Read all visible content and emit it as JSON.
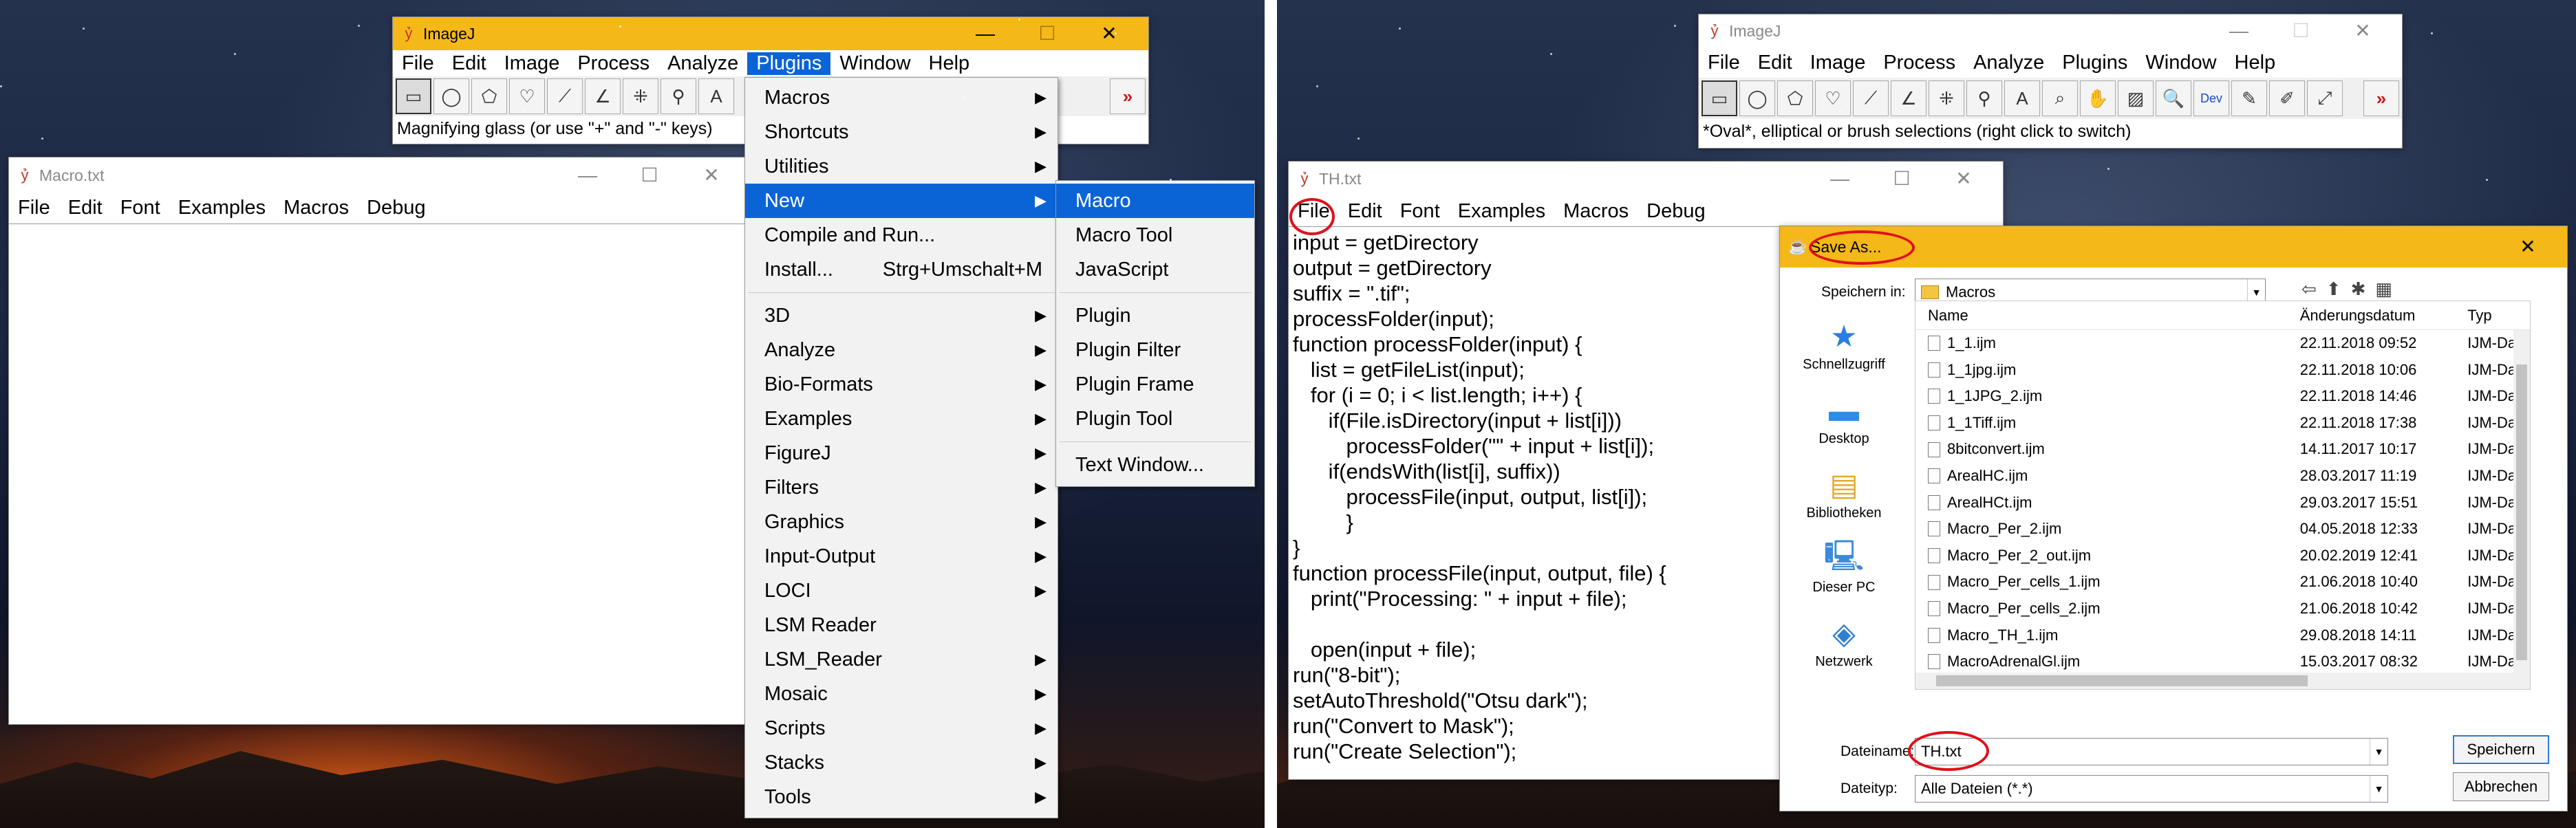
{
  "left_screen": {
    "imagej": {
      "title": "ImageJ",
      "menus": [
        "File",
        "Edit",
        "Image",
        "Process",
        "Analyze",
        "Plugins",
        "Window",
        "Help"
      ],
      "open_menu": "Plugins",
      "tools": [
        {
          "icon": "rectangle-tool-icon",
          "glyph": "▭"
        },
        {
          "icon": "oval-tool-icon",
          "glyph": "◯"
        },
        {
          "icon": "polygon-tool-icon",
          "glyph": "⬠"
        },
        {
          "icon": "freehand-tool-icon",
          "glyph": "♡"
        },
        {
          "icon": "line-tool-icon",
          "glyph": "⟋"
        },
        {
          "icon": "angle-tool-icon",
          "glyph": "∠"
        },
        {
          "icon": "point-tool-icon",
          "glyph": "⁜"
        },
        {
          "icon": "wand-tool-icon",
          "glyph": "⚲"
        },
        {
          "icon": "text-tool-icon",
          "glyph": "A"
        }
      ],
      "more_tools_glyph": "»",
      "status": "Magnifying glass (or use \"+\" and \"-\" keys)"
    },
    "macro_window": {
      "title": "Macro.txt",
      "menus": [
        "File",
        "Edit",
        "Font",
        "Examples",
        "Macros",
        "Debug"
      ]
    },
    "plugins_menu": {
      "items": [
        {
          "label": "Macros",
          "submenu": true
        },
        {
          "label": "Shortcuts",
          "submenu": true
        },
        {
          "label": "Utilities",
          "submenu": true
        },
        {
          "label": "New",
          "submenu": true,
          "highlighted": true
        },
        {
          "label": "Compile and Run...",
          "submenu": false
        },
        {
          "label": "Install...",
          "submenu": false,
          "shortcut": "Strg+Umschalt+M"
        },
        {
          "separator": true
        },
        {
          "label": "3D",
          "submenu": true
        },
        {
          "label": "Analyze",
          "submenu": true
        },
        {
          "label": "Bio-Formats",
          "submenu": true
        },
        {
          "label": "Examples",
          "submenu": true
        },
        {
          "label": "FigureJ",
          "submenu": true
        },
        {
          "label": "Filters",
          "submenu": true
        },
        {
          "label": "Graphics",
          "submenu": true
        },
        {
          "label": "Input-Output",
          "submenu": true
        },
        {
          "label": "LOCI",
          "submenu": true
        },
        {
          "label": "LSM Reader",
          "submenu": false
        },
        {
          "label": "LSM_Reader",
          "submenu": true
        },
        {
          "label": "Mosaic",
          "submenu": true
        },
        {
          "label": "Scripts",
          "submenu": true
        },
        {
          "label": "Stacks",
          "submenu": true
        },
        {
          "label": "Tools",
          "submenu": true
        }
      ]
    },
    "new_submenu": {
      "items": [
        {
          "label": "Macro",
          "highlighted": true
        },
        {
          "label": "Macro Tool"
        },
        {
          "label": "JavaScript"
        },
        {
          "separator": true
        },
        {
          "label": "Plugin"
        },
        {
          "label": "Plugin Filter"
        },
        {
          "label": "Plugin Frame"
        },
        {
          "label": "Plugin Tool"
        },
        {
          "separator": true
        },
        {
          "label": "Text Window..."
        }
      ]
    }
  },
  "right_screen": {
    "imagej": {
      "title": "ImageJ",
      "menus": [
        "File",
        "Edit",
        "Image",
        "Process",
        "Analyze",
        "Plugins",
        "Window",
        "Help"
      ],
      "tools": [
        {
          "icon": "rectangle-tool-icon",
          "glyph": "▭"
        },
        {
          "icon": "oval-tool-icon",
          "glyph": "◯"
        },
        {
          "icon": "polygon-tool-icon",
          "glyph": "⬠"
        },
        {
          "icon": "freehand-tool-icon",
          "glyph": "♡"
        },
        {
          "icon": "line-tool-icon",
          "glyph": "⟋"
        },
        {
          "icon": "angle-tool-icon",
          "glyph": "∠"
        },
        {
          "icon": "point-tool-icon",
          "glyph": "⁜"
        },
        {
          "icon": "wand-tool-icon",
          "glyph": "⚲"
        },
        {
          "icon": "text-tool-icon",
          "glyph": "A"
        },
        {
          "icon": "magnifier-tool-icon",
          "glyph": "⌕"
        },
        {
          "icon": "hand-tool-icon",
          "glyph": "✋"
        },
        {
          "icon": "dropper-tool-icon",
          "glyph": "▨"
        },
        {
          "icon": "zoom-tool-icon",
          "glyph": "🔍"
        },
        {
          "icon": "dev-tool-icon",
          "glyph": "Dev"
        },
        {
          "icon": "pencil-tool-icon",
          "glyph": "✎"
        },
        {
          "icon": "brush-tool-icon",
          "glyph": "✐"
        },
        {
          "icon": "flood-fill-tool-icon",
          "glyph": "⤢"
        }
      ],
      "more_tools_glyph": "»",
      "status": "*Oval*, elliptical or brush selections (right click to switch)"
    },
    "th_window": {
      "title": "TH.txt",
      "menus": [
        "File",
        "Edit",
        "Font",
        "Examples",
        "Macros",
        "Debug"
      ],
      "code": [
        "input = getDirectory",
        "output = getDirectory",
        "suffix = \".tif\";",
        "processFolder(input);",
        "function processFolder(input) {",
        "   list = getFileList(input);",
        "   for (i = 0; i < list.length; i++) {",
        "      if(File.isDirectory(input + list[i]))",
        "         processFolder(\"\" + input + list[i]);",
        "      if(endsWith(list[i], suffix))",
        "         processFile(input, output, list[i]);",
        "         }",
        "}",
        "function processFile(input, output, file) {",
        "   print(\"Processing: \" + input + file);",
        "",
        "   open(input + file);",
        "run(\"8-bit\");",
        "setAutoThreshold(\"Otsu dark\");",
        "run(\"Convert to Mask\");",
        "run(\"Create Selection\");"
      ]
    },
    "save_dialog": {
      "title": "Save As...",
      "save_in_label": "Speichern in:",
      "save_in_value": "Macros",
      "columns": [
        "Name",
        "Änderungsdatum",
        "Typ"
      ],
      "places": [
        {
          "label": "Schnellzugriff",
          "icon": "star-icon"
        },
        {
          "label": "Desktop",
          "icon": "desktop-icon"
        },
        {
          "label": "Bibliotheken",
          "icon": "libraries-icon"
        },
        {
          "label": "Dieser PC",
          "icon": "computer-icon"
        },
        {
          "label": "Netzwerk",
          "icon": "network-icon"
        }
      ],
      "files": [
        {
          "name": "1_1.ijm",
          "date": "22.11.2018 09:52",
          "type": "IJM-Da"
        },
        {
          "name": "1_1jpg.ijm",
          "date": "22.11.2018 10:06",
          "type": "IJM-Da"
        },
        {
          "name": "1_1JPG_2.ijm",
          "date": "22.11.2018 14:46",
          "type": "IJM-Da"
        },
        {
          "name": "1_1Tiff.ijm",
          "date": "22.11.2018 17:38",
          "type": "IJM-Da"
        },
        {
          "name": "8bitconvert.ijm",
          "date": "14.11.2017 10:17",
          "type": "IJM-Da"
        },
        {
          "name": "ArealHC.ijm",
          "date": "28.03.2017 11:19",
          "type": "IJM-Da"
        },
        {
          "name": "ArealHCt.ijm",
          "date": "29.03.2017 15:51",
          "type": "IJM-Da"
        },
        {
          "name": "Macro_Per_2.ijm",
          "date": "04.05.2018 12:33",
          "type": "IJM-Da"
        },
        {
          "name": "Macro_Per_2_out.ijm",
          "date": "20.02.2019 12:41",
          "type": "IJM-Da"
        },
        {
          "name": "Macro_Per_cells_1.ijm",
          "date": "21.06.2018 10:40",
          "type": "IJM-Da"
        },
        {
          "name": "Macro_Per_cells_2.ijm",
          "date": "21.06.2018 10:42",
          "type": "IJM-Da"
        },
        {
          "name": "Macro_TH_1.ijm",
          "date": "29.08.2018 14:11",
          "type": "IJM-Da"
        },
        {
          "name": "MacroAdrenalGl.ijm",
          "date": "15.03.2017 08:32",
          "type": "IJM-Da"
        }
      ],
      "filename_label": "Dateiname:",
      "filename_value": "TH.txt",
      "filetype_label": "Dateityp:",
      "filetype_value": "Alle Dateien (*.*)",
      "save_button": "Speichern",
      "cancel_button": "Abbrechen"
    }
  },
  "colors": {
    "imagej_title_bar": "#f5b819",
    "menu_highlight": "#0a64d6",
    "annotation_ring": "#e0101a"
  }
}
